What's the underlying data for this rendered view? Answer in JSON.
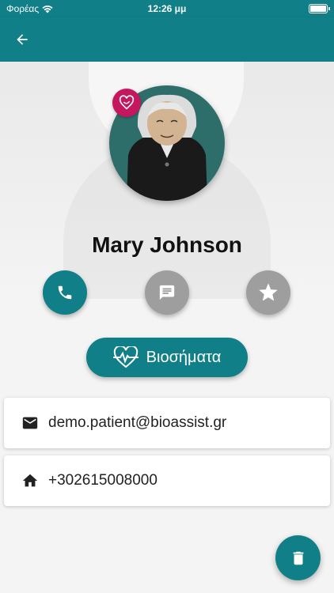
{
  "status_bar": {
    "carrier": "Φορέας",
    "time": "12:26 μμ"
  },
  "app_bar": {
    "back_icon": "arrow-back-icon"
  },
  "profile": {
    "name": "Mary Johnson",
    "favorite_badge_icon": "heart-badge-icon"
  },
  "actions": {
    "call_icon": "phone-icon",
    "message_icon": "message-icon",
    "favorite_icon": "star-icon"
  },
  "vitals_button": {
    "label": "Βιοσήματα",
    "icon": "heartbeat-icon"
  },
  "contact": {
    "email": "demo.patient@bioassist.gr",
    "email_icon": "email-icon",
    "phone": "+302615008000",
    "phone_icon": "home-icon"
  },
  "fab": {
    "icon": "trash-icon"
  },
  "colors": {
    "primary": "#117f87",
    "secondary_button": "#9e9e9e",
    "badge": "#c4175f"
  }
}
